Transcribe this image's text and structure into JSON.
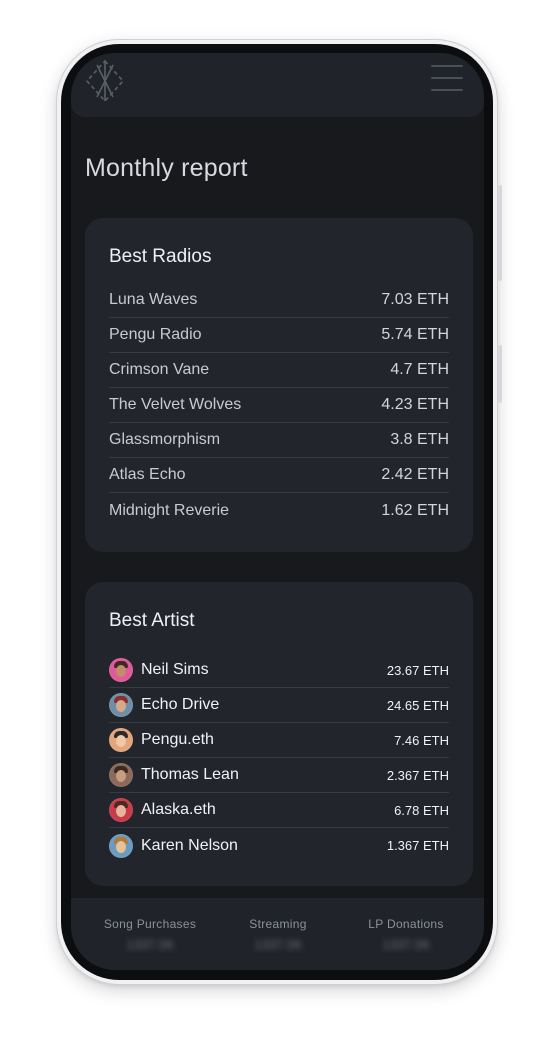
{
  "header": {
    "logo_icon": "dashed-diamond-logo-icon",
    "menu_icon": "hamburger-menu-icon"
  },
  "page": {
    "title": "Monthly report"
  },
  "best_radios": {
    "title": "Best Radios",
    "items": [
      {
        "name": "Luna Waves",
        "value": "7.03 ETH"
      },
      {
        "name": "Pengu Radio",
        "value": "5.74 ETH"
      },
      {
        "name": "Crimson Vane",
        "value": "4.7 ETH"
      },
      {
        "name": "The Velvet Wolves",
        "value": "4.23 ETH"
      },
      {
        "name": "Glassmorphism",
        "value": "3.8 ETH"
      },
      {
        "name": "Atlas Echo",
        "value": "2.42 ETH"
      },
      {
        "name": "Midnight Reverie",
        "value": "1.62 ETH"
      }
    ]
  },
  "best_artist": {
    "title": "Best Artist",
    "items": [
      {
        "name": "Neil Sims",
        "value": "23.67 ETH",
        "avatar_colors": [
          "#e05a9b",
          "#3e2a24",
          "#c08c6a"
        ]
      },
      {
        "name": "Echo Drive",
        "value": "24.65 ETH",
        "avatar_colors": [
          "#6d8fa8",
          "#8a2f2a",
          "#d9a88a"
        ]
      },
      {
        "name": "Pengu.eth",
        "value": "7.46 ETH",
        "avatar_colors": [
          "#e2a57c",
          "#2b2b2b",
          "#f2c8a6"
        ]
      },
      {
        "name": "Thomas Lean",
        "value": "2.367 ETH",
        "avatar_colors": [
          "#8a6a5a",
          "#3a2a22",
          "#c99b80"
        ]
      },
      {
        "name": "Alaska.eth",
        "value": "6.78 ETH",
        "avatar_colors": [
          "#c83b4a",
          "#4a2a22",
          "#e6b59a"
        ]
      },
      {
        "name": "Karen Nelson",
        "value": "1.367 ETH",
        "avatar_colors": [
          "#6a9bc0",
          "#b07a3a",
          "#e8c09a"
        ]
      }
    ]
  },
  "footer": {
    "stats": [
      {
        "label": "Song Purchases",
        "value": "1337.06"
      },
      {
        "label": "Streaming",
        "value": "1337.06"
      },
      {
        "label": "LP Donations",
        "value": "1337.06"
      }
    ]
  }
}
